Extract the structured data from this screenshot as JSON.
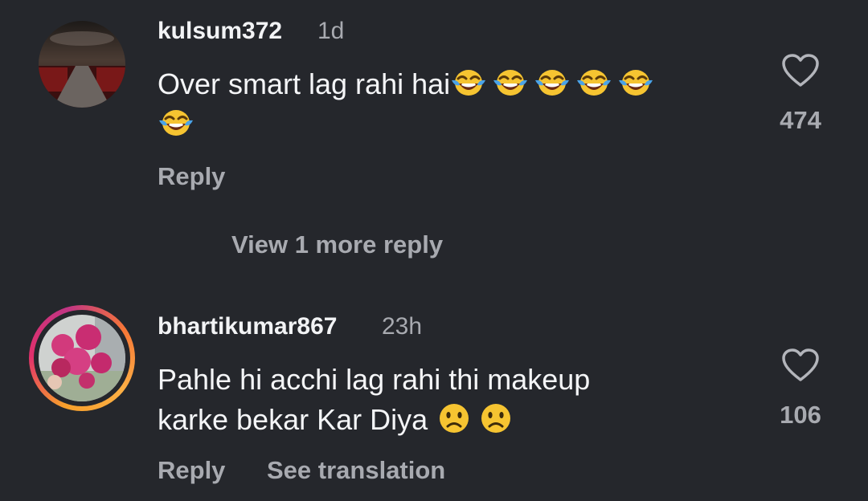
{
  "comments": [
    {
      "username": "kulsum372",
      "time": "1d",
      "text": "Over smart lag rahi hai",
      "emojis": [
        "face-with-tears-of-joy",
        "face-with-tears-of-joy",
        "face-with-tears-of-joy",
        "face-with-tears-of-joy",
        "face-with-tears-of-joy",
        "face-with-tears-of-joy"
      ],
      "likes": "474",
      "reply_label": "Reply",
      "view_replies_label": "View 1 more reply"
    },
    {
      "username": "bhartikumar867",
      "time": "23h",
      "text_line1": "Pahle hi acchi lag rahi thi makeup",
      "text_line2": "karke bekar Kar Diya ",
      "emojis": [
        "slightly-frowning-face",
        "slightly-frowning-face"
      ],
      "likes": "106",
      "reply_label": "Reply",
      "translate_label": "See translation",
      "has_story_ring": true
    }
  ],
  "colors": {
    "background": "#25272c",
    "primary_text": "#f2f3f5",
    "secondary_text": "#a8aab0",
    "story_ring": [
      "#f8a02b",
      "#e1306c",
      "#c13584"
    ]
  }
}
